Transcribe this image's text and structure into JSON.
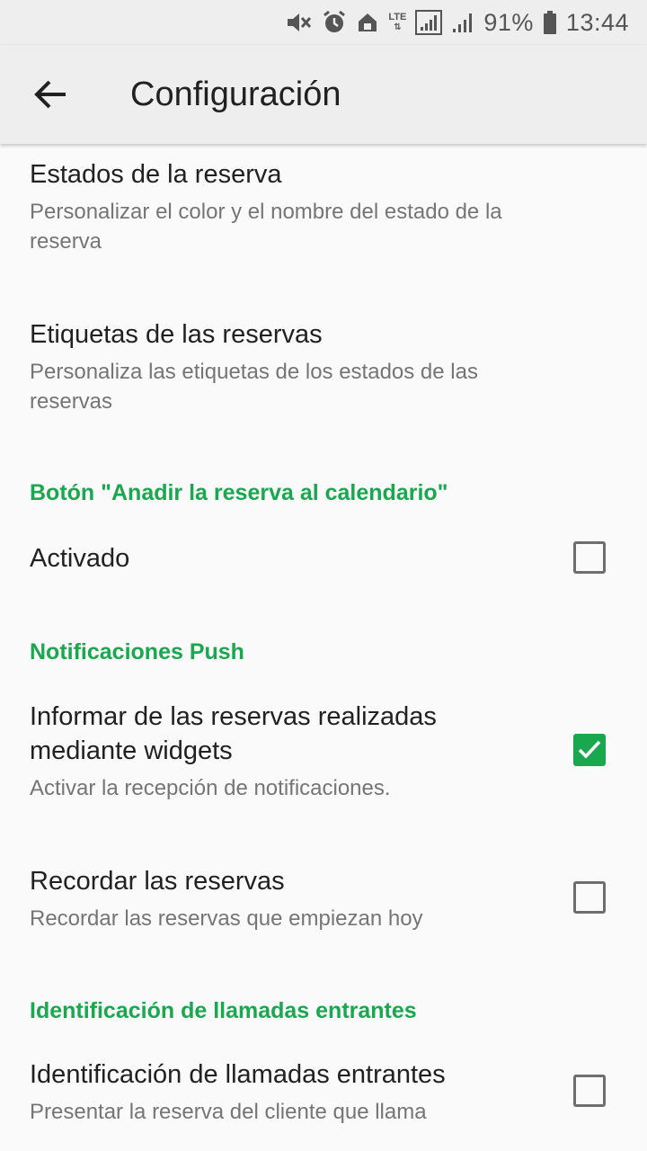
{
  "status_bar": {
    "battery": "91%",
    "time": "13:44",
    "icons": [
      "mute-icon",
      "alarm-icon",
      "home-icon",
      "lte-icon",
      "signal-icon",
      "signal-icon",
      "battery-icon"
    ],
    "lte": "LTE"
  },
  "app_bar": {
    "title": "Configuración",
    "back_icon": "arrow-left-icon"
  },
  "items": {
    "estados": {
      "title": "Estados de la reserva",
      "summary_line1": "Personalizar el color y el nombre del estado de la",
      "summary_line2": "reserva"
    },
    "etiquetas": {
      "title": "Etiquetas de las reservas",
      "summary_line1": "Personaliza las etiquetas de los estados de las",
      "summary_line2": "reservas"
    },
    "section_calendar": "Botón \"Anadir la reserva al calendario\"",
    "activado": {
      "title": "Activado",
      "checked": false
    },
    "section_push": "Notificaciones Push",
    "informar": {
      "title_line1": "Informar de las reservas realizadas",
      "title_line2": "mediante widgets",
      "summary": "Activar la recepción de notificaciones.",
      "checked": true
    },
    "recordar": {
      "title": "Recordar las reservas",
      "summary": "Recordar las reservas que empiezan hoy",
      "checked": false
    },
    "section_calls": "Identificación de llamadas entrantes",
    "identificacion": {
      "title": "Identificación de llamadas entrantes",
      "summary": "Presentar la reserva del cliente que llama",
      "checked": false
    }
  },
  "colors": {
    "accent": "#1aa84f",
    "bar": "#eeeeee",
    "background": "#fafafa",
    "primary_text": "#212121",
    "secondary_text": "#757575"
  }
}
